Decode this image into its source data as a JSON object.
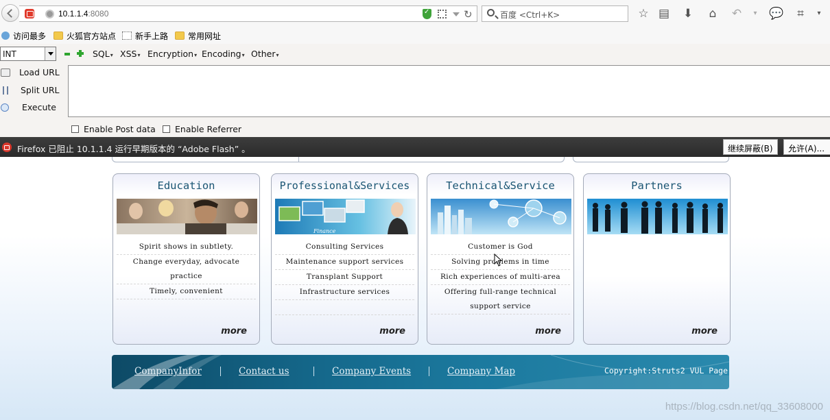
{
  "browser": {
    "url_host": "10.1.1.4",
    "url_port": ":8080",
    "search_placeholder": "百度 <Ctrl+K>"
  },
  "bookmarks": [
    {
      "label": "访问最多",
      "icon": "most-visited-icon"
    },
    {
      "label": "火狐官方站点",
      "icon": "folder-icon"
    },
    {
      "label": "新手上路",
      "icon": "dotted-page-icon"
    },
    {
      "label": "常用网址",
      "icon": "folder-icon"
    }
  ],
  "hackbar": {
    "type_value": "INT",
    "menus": [
      "SQL",
      "XSS",
      "Encryption",
      "Encoding",
      "Other"
    ],
    "load_url": "Load URL",
    "split_url": "Split URL",
    "execute": "Execute",
    "post_label": "Enable Post data",
    "referrer_label": "Enable Referrer",
    "textarea_value": ""
  },
  "notification": {
    "text": "Firefox 已阻止 10.1.1.4 运行早期版本的 “Adobe Flash” 。",
    "continue_block": "继续屏蔽(B)",
    "allow": "允许(A)..."
  },
  "cards": [
    {
      "title": "Education",
      "items": [
        "Spirit shows in subtlety.",
        "Change everyday, advocate practice",
        "Timely, convenient"
      ],
      "more": "more"
    },
    {
      "title": "Professional&Services",
      "items": [
        "Consulting Services",
        "Maintenance support services",
        "Transplant Support",
        "Infrastructure services"
      ],
      "more": "more",
      "img_caption": "Finance"
    },
    {
      "title": "Technical&Service",
      "items": [
        "Customer is God",
        "Solving problems in time",
        "Rich experiences of multi-area",
        "Offering full-range technical support service"
      ],
      "more": "more"
    },
    {
      "title": "Partners",
      "items": [],
      "more": "more"
    }
  ],
  "footer": {
    "links": [
      "CompanyInfor",
      "Contact us",
      "Company Events",
      "Company Map"
    ],
    "copyright": "Copyright:Struts2 VUL Page"
  },
  "watermark": "https://blog.csdn.net/qq_33608000"
}
